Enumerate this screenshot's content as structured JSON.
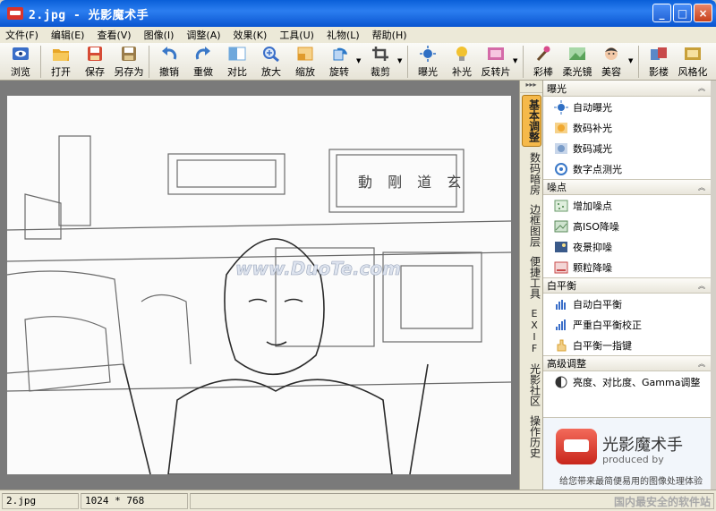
{
  "window": {
    "title": "2.jpg - 光影魔术手",
    "buttons": {
      "minimize": "_",
      "maximize": "□",
      "close": "×"
    }
  },
  "menu": [
    "文件(F)",
    "编辑(E)",
    "查看(V)",
    "图像(I)",
    "调整(A)",
    "效果(K)",
    "工具(U)",
    "礼物(L)",
    "帮助(H)"
  ],
  "toolbar": [
    {
      "label": "浏览",
      "icon": "eye-icon",
      "color": "#3a6ec8"
    },
    {
      "label": "打开",
      "icon": "folder-open-icon",
      "color": "#e8a627"
    },
    {
      "label": "保存",
      "icon": "save-icon",
      "color": "#d64b35"
    },
    {
      "label": "另存为",
      "icon": "save-as-icon",
      "color": "#9a7c4a"
    },
    {
      "label": "撤销",
      "icon": "undo-icon",
      "color": "#3a78c8"
    },
    {
      "label": "重做",
      "icon": "redo-icon",
      "color": "#3a78c8"
    },
    {
      "label": "对比",
      "icon": "compare-icon",
      "color": "#6fa8dc"
    },
    {
      "label": "放大",
      "icon": "zoom-in-icon",
      "color": "#3a6ec8"
    },
    {
      "label": "缩放",
      "icon": "resize-icon",
      "color": "#e09b2c"
    },
    {
      "label": "旋转",
      "icon": "rotate-icon",
      "color": "#2c79c8"
    },
    {
      "label": "裁剪",
      "icon": "crop-icon",
      "color": "#4a4a4a"
    },
    {
      "label": "曝光",
      "icon": "exposure-icon",
      "color": "#2f6fc4"
    },
    {
      "label": "补光",
      "icon": "fill-light-icon",
      "color": "#f2c230"
    },
    {
      "label": "反转片",
      "icon": "reversal-film-icon",
      "color": "#d46ba8"
    },
    {
      "label": "彩棒",
      "icon": "color-wand-icon",
      "color": "#d84a8a"
    },
    {
      "label": "柔光镜",
      "icon": "soft-light-icon",
      "color": "#5aa35a"
    },
    {
      "label": "美容",
      "icon": "beauty-icon",
      "color": "#e89a6a"
    },
    {
      "label": "影楼",
      "icon": "studio-icon",
      "color": "#5a88c8"
    },
    {
      "label": "风格化",
      "icon": "stylize-icon",
      "color": "#c8a03a"
    }
  ],
  "vtabs": [
    {
      "label": "基本调整",
      "active": true
    },
    {
      "label": "数码暗房",
      "active": false
    },
    {
      "label": "边框图层",
      "active": false
    },
    {
      "label": "便捷工具",
      "active": false
    },
    {
      "label": "EXIF",
      "active": false
    },
    {
      "label": "光影社区",
      "active": false
    },
    {
      "label": "操作历史",
      "active": false
    }
  ],
  "panel": {
    "sections": [
      {
        "title": "曝光",
        "items": [
          {
            "label": "自动曝光",
            "icon": "auto-exposure-icon",
            "color": "#2f6fc4"
          },
          {
            "label": "数码补光",
            "icon": "digital-fill-icon",
            "color": "#f0a830"
          },
          {
            "label": "数码减光",
            "icon": "digital-dim-icon",
            "color": "#7a9cc8"
          },
          {
            "label": "数字点测光",
            "icon": "spot-meter-icon",
            "color": "#3a78c8"
          }
        ]
      },
      {
        "title": "噪点",
        "items": [
          {
            "label": "增加噪点",
            "icon": "add-noise-icon",
            "color": "#6a9a6a"
          },
          {
            "label": "高ISO降噪",
            "icon": "iso-denoise-icon",
            "color": "#5a8a5a"
          },
          {
            "label": "夜景抑噪",
            "icon": "night-denoise-icon",
            "color": "#3a5a8a"
          },
          {
            "label": "颗粒降噪",
            "icon": "grain-denoise-icon",
            "color": "#c84a4a"
          }
        ]
      },
      {
        "title": "白平衡",
        "items": [
          {
            "label": "自动白平衡",
            "icon": "auto-wb-icon",
            "color": "#3a6ec8"
          },
          {
            "label": "严重白平衡校正",
            "icon": "wb-correct-icon",
            "color": "#3a6ec8"
          },
          {
            "label": "白平衡一指键",
            "icon": "wb-finger-icon",
            "color": "#d8a030"
          }
        ]
      },
      {
        "title": "高级调整",
        "items": [
          {
            "label": "亮度、对比度、Gamma调整",
            "icon": "brightness-contrast-icon",
            "color": "#333333"
          }
        ]
      }
    ],
    "promo": {
      "title": "光影魔术手",
      "subtitle": "produced by",
      "desc": "给您带来最简便易用的图像处理体验"
    }
  },
  "status": {
    "filename": "2.jpg",
    "dimensions": "1024 * 768",
    "watermark": "国内最安全的软件站"
  },
  "photo_watermark": "www.DuoTe.com"
}
